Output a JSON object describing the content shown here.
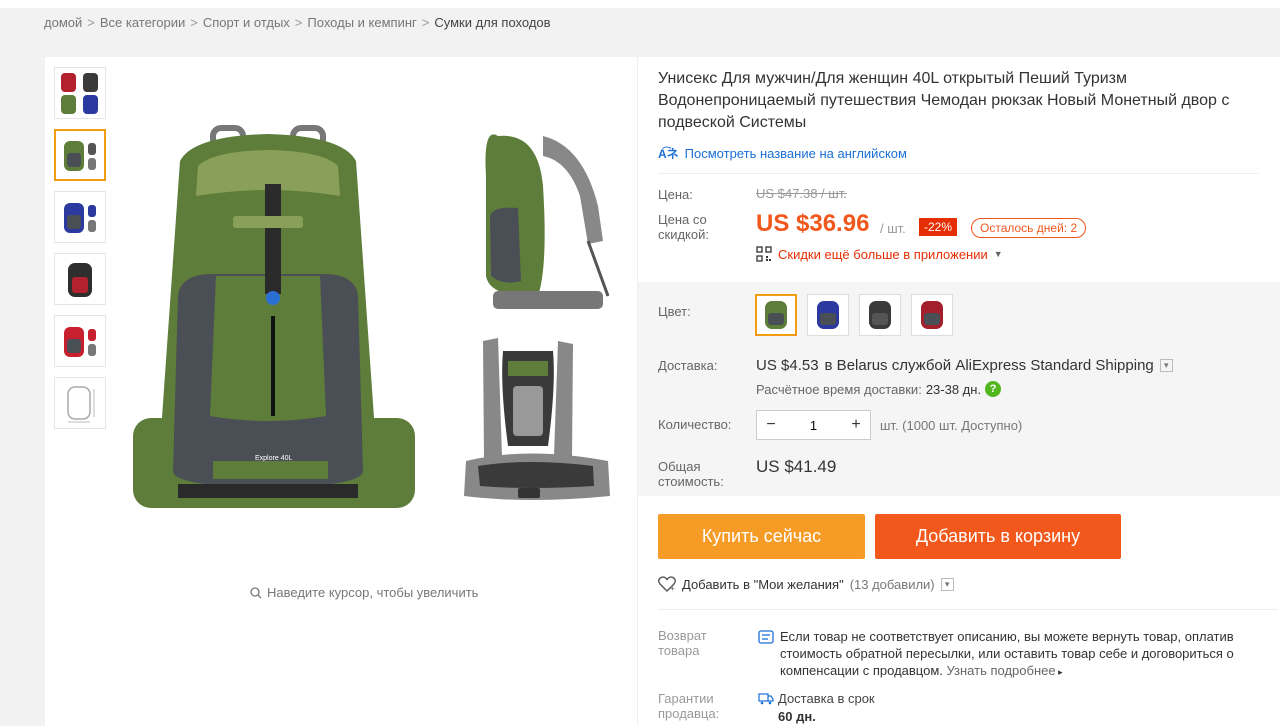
{
  "breadcrumb": {
    "items": [
      "домой",
      "Все категории",
      "Спорт и отдых",
      "Походы и кемпинг",
      "Сумки для походов"
    ],
    "separator": ">"
  },
  "gallery": {
    "zoom_hint": "Наведите курсор, чтобы увеличить",
    "main_logo_text": "Explore 40L"
  },
  "product": {
    "title": "Унисекс Для мужчин/Для женщин 40L открытый Пеший Туризм Водонепроницаемый путешествия Чемодан рюкзак Новый Монетный двор с подвеской Системы",
    "translate_link": "Посмотреть название на английском"
  },
  "pricing": {
    "price_label": "Цена:",
    "old_price": "US $47.38 / шт.",
    "discount_label": "Цена со скидкой:",
    "price": "US $36.96",
    "unit": "/ шт.",
    "discount_badge": "-22%",
    "days_left": "Осталось дней: 2",
    "app_deal": "Скидки ещё больше в приложении"
  },
  "options": {
    "color_label": "Цвет:",
    "colors": [
      "#5e7d3a",
      "#2c3aa0",
      "#3a3a3a",
      "#a31f2c"
    ]
  },
  "shipping": {
    "label": "Доставка:",
    "price": "US $4.53",
    "text": "в Belarus службой AliExpress Standard Shipping",
    "eta_label": "Расчётное время доставки:",
    "eta_value": "23-38 дн."
  },
  "quantity": {
    "label": "Количество:",
    "value": "1",
    "available": "шт. (1000 шт. Доступно)"
  },
  "total": {
    "label": "Общая стоимость:",
    "value": "US $41.49"
  },
  "actions": {
    "buy_now": "Купить сейчас",
    "add_to_cart": "Добавить в корзину",
    "wishlist": "Добавить в \"Мои желания\"",
    "wishlist_count": "(13 добавили)"
  },
  "returns": {
    "label": "Возврат товара",
    "text": "Если товар не соответствует описанию, вы можете вернуть товар, оплатив стоимость обратной пересылки, или оставить товар себе и договориться о компенсации с продавцом.",
    "more": "Узнать подробнее"
  },
  "guarantee": {
    "label": "Гарантии продавца:",
    "title": "Доставка в срок",
    "value": "60 дн."
  }
}
